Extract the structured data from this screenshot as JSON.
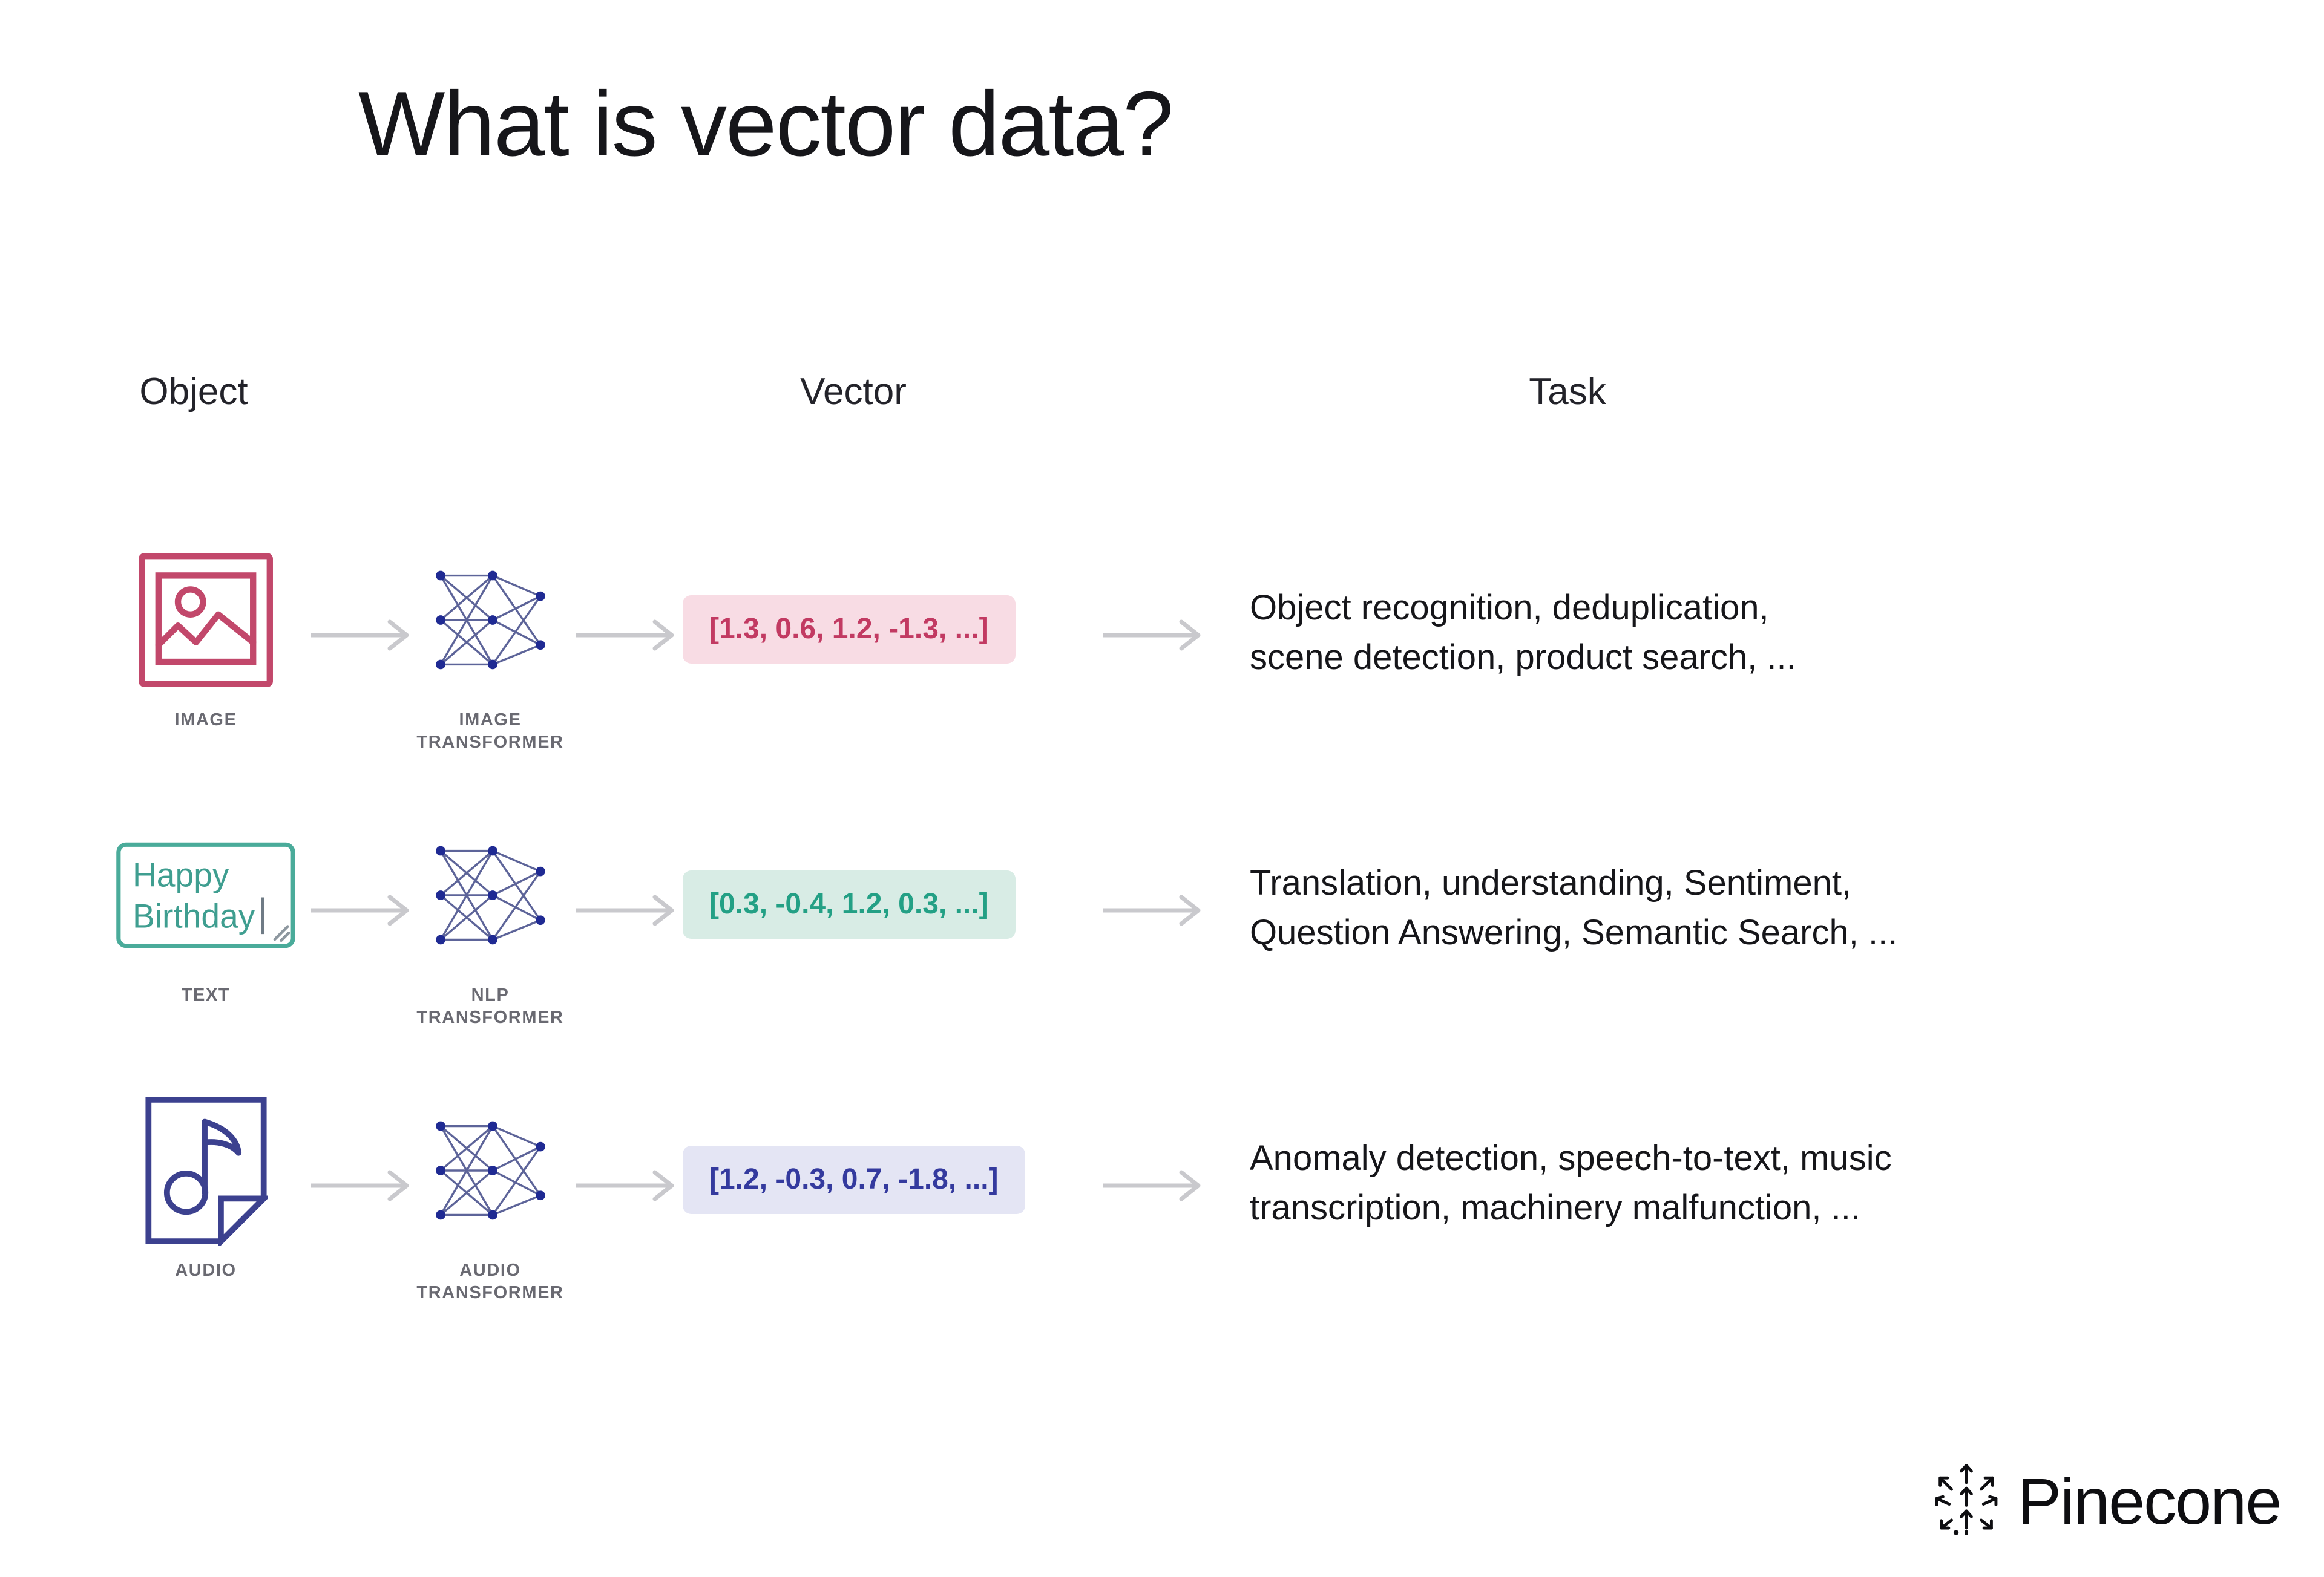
{
  "slide": {
    "title": "What is vector data?"
  },
  "columns": {
    "object": "Object",
    "vector": "Vector",
    "task": "Task"
  },
  "rows": [
    {
      "id": "image",
      "object_caption": "IMAGE",
      "object_icon": "picture-frame-icon",
      "transformer_caption": "IMAGE\nTRANSFORMER",
      "transformer_icon": "neural-network-icon",
      "vector": "[1.3, 0.6, 1.2, -1.3, ...]",
      "vector_pill_bg": "#f8dce4",
      "vector_text_color": "#c23a62",
      "accent": "#c2486b",
      "task": "Object recognition, deduplication,\nscene detection, product search, ..."
    },
    {
      "id": "text",
      "object_caption": "TEXT",
      "object_icon": "text-box-icon",
      "object_text_line1": "Happy",
      "object_text_line2": "Birthday",
      "transformer_caption": "NLP\nTRANSFORMER",
      "transformer_icon": "neural-network-icon",
      "vector": "[0.3, -0.4, 1.2, 0.3, ...]",
      "vector_pill_bg": "#d8ece5",
      "vector_text_color": "#23a085",
      "accent": "#4aab9a",
      "task": "Translation, understanding, Sentiment,\nQuestion Answering, Semantic Search, ..."
    },
    {
      "id": "audio",
      "object_caption": "AUDIO",
      "object_icon": "audio-file-icon",
      "transformer_caption": "AUDIO\nTRANSFORMER",
      "transformer_icon": "neural-network-icon",
      "vector": "[1.2, -0.3, 0.7, -1.8, ...]",
      "vector_pill_bg": "#e4e5f4",
      "vector_text_color": "#343a9e",
      "accent": "#3c418f",
      "task": "Anomaly detection, speech-to-text, music\ntranscription, machinery malfunction, ..."
    }
  ],
  "branding": {
    "wordmark": "Pinecone",
    "logo_icon": "pinecone-arrows-logo"
  },
  "arrow_color": "#c9c9cd"
}
